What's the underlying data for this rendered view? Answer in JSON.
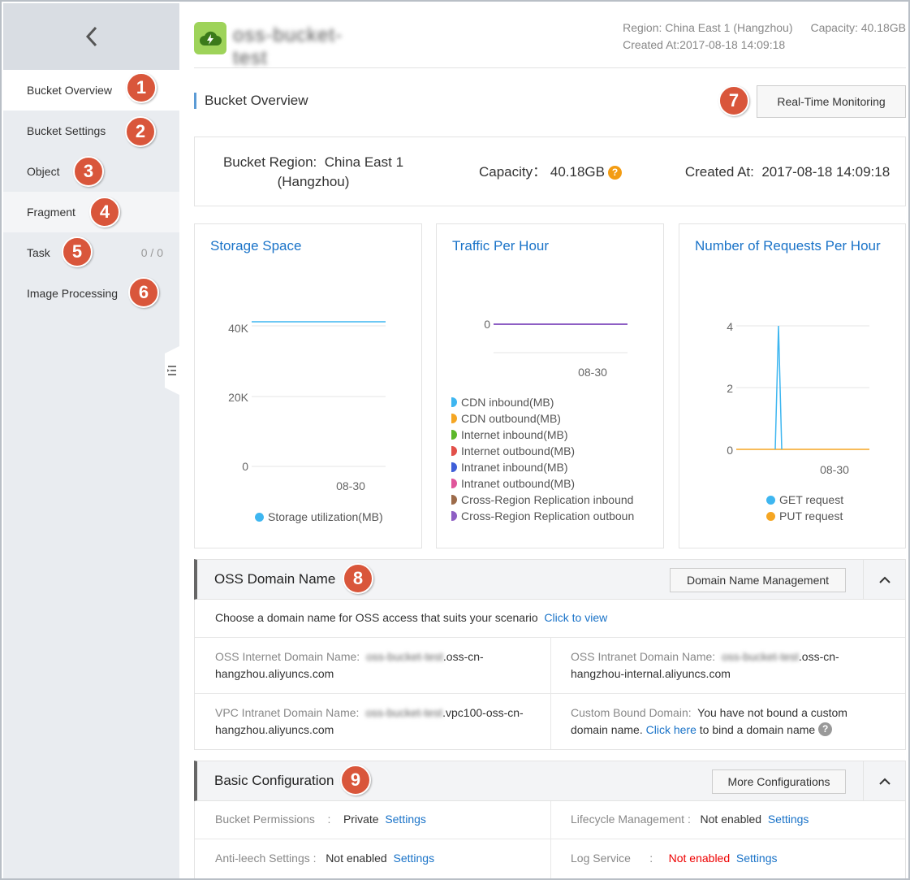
{
  "sidebar": {
    "items": [
      {
        "label": "Bucket Overview",
        "marker": "1"
      },
      {
        "label": "Bucket Settings",
        "marker": "2"
      },
      {
        "label": "Object",
        "marker": "3"
      },
      {
        "label": "Fragment",
        "marker": "4"
      },
      {
        "label": "Task",
        "marker": "5",
        "count": "0 / 0"
      },
      {
        "label": "Image Processing",
        "marker": "6"
      }
    ]
  },
  "header": {
    "bucket_name": "oss-bucket-test",
    "region": "Region: China East 1 (Hangzhou)",
    "capacity": "Capacity: 40.18GB",
    "created": "Created At:2017-08-18 14:09:18"
  },
  "overview": {
    "title": "Bucket Overview",
    "realtime_button": "Real-Time Monitoring",
    "marker": "7",
    "region_label": "Bucket Region:",
    "region_value_1": "China East 1",
    "region_value_2": "(Hangzhou)",
    "capacity_label": "Capacity：",
    "capacity_value": "40.18GB",
    "created_label": "Created At:",
    "created_value": "2017-08-18 14:09:18"
  },
  "chart_data": [
    {
      "type": "line",
      "title": "Storage Space",
      "x": [
        "08-30"
      ],
      "yticks": [
        "0",
        "20K",
        "40K"
      ],
      "ylim": [
        0,
        40000
      ],
      "series": [
        {
          "name": "Storage utilization(MB)",
          "color": "#3eb6f0",
          "values": [
            41144
          ]
        }
      ]
    },
    {
      "type": "line",
      "title": "Traffic Per Hour",
      "x": [
        "08-30"
      ],
      "yticks": [
        "0"
      ],
      "series": [
        {
          "name": "CDN inbound(MB)",
          "color": "#3eb6f0",
          "values": [
            0
          ]
        },
        {
          "name": "CDN outbound(MB)",
          "color": "#f5a623",
          "values": [
            0
          ]
        },
        {
          "name": "Internet inbound(MB)",
          "color": "#5cb82a",
          "values": [
            0
          ]
        },
        {
          "name": "Internet outbound(MB)",
          "color": "#e2504a",
          "values": [
            0
          ]
        },
        {
          "name": "Intranet inbound(MB)",
          "color": "#3f5fd8",
          "values": [
            0
          ]
        },
        {
          "name": "Intranet outbound(MB)",
          "color": "#e0569b",
          "values": [
            0
          ]
        },
        {
          "name": "Cross-Region Replication inbound",
          "color": "#9c6b4a",
          "values": [
            0
          ]
        },
        {
          "name": "Cross-Region Replication outboun",
          "color": "#8e5fc4",
          "values": [
            0
          ]
        }
      ]
    },
    {
      "type": "line",
      "title": "Number of Requests Per Hour",
      "x": [
        "08-30"
      ],
      "yticks": [
        "0",
        "2",
        "4"
      ],
      "ylim": [
        0,
        4
      ],
      "series": [
        {
          "name": "GET request",
          "color": "#3eb6f0",
          "values": [
            0,
            4,
            0
          ]
        },
        {
          "name": "PUT request",
          "color": "#f5a623",
          "values": [
            0,
            0,
            0
          ]
        }
      ]
    }
  ],
  "domain_panel": {
    "title": "OSS Domain Name",
    "marker": "8",
    "button": "Domain Name Management",
    "intro": "Choose a domain name for OSS access that suits your scenario",
    "intro_link": "Click to view",
    "internet_label": "OSS Internet Domain Name:",
    "internet_prefix": "oss-bucket-test",
    "internet_suffix_1": ".oss-cn-",
    "internet_suffix_2": "hangzhou.aliyuncs.com",
    "intranet_label": "OSS Intranet Domain Name:",
    "intranet_prefix": "oss-bucket-test",
    "intranet_suffix_1": ".oss-cn-",
    "intranet_suffix_2": "hangzhou-internal.aliyuncs.com",
    "vpc_label": "VPC Intranet Domain Name:",
    "vpc_prefix": "oss-bucket-test",
    "vpc_suffix_1": ".vpc100-oss-cn-",
    "vpc_suffix_2": "hangzhou.aliyuncs.com",
    "custom_label": "Custom Bound Domain:",
    "custom_text_1": "You have not bound a custom",
    "custom_text_2": "domain name.",
    "custom_link": "Click here",
    "custom_text_3": "to bind a domain name"
  },
  "config_panel": {
    "title": "Basic Configuration",
    "marker": "9",
    "button": "More Configurations",
    "permissions_label": "Bucket Permissions",
    "permissions_value": "Private",
    "lifecycle_label": "Lifecycle Management",
    "lifecycle_value": "Not enabled",
    "antileech_label": "Anti-leech Settings",
    "antileech_value": "Not enabled",
    "log_label": "Log Service",
    "log_value": "Not enabled",
    "settings_link": "Settings",
    "colon": ":"
  }
}
